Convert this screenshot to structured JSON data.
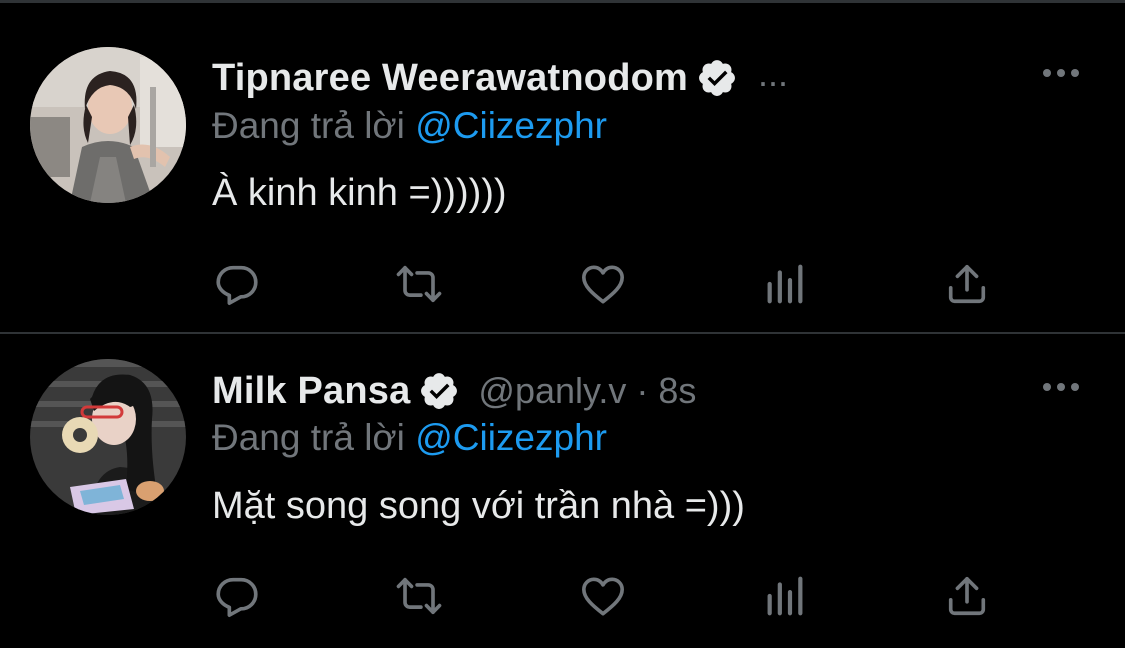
{
  "tweets": [
    {
      "display_name": "Tipnaree Weerawatnodom",
      "verified": true,
      "handle": "",
      "time": "",
      "header_overflow": "...",
      "replying_prefix": "Đang trả lời",
      "replying_to": "@Ciizezphr",
      "text": "À kinh kinh =))))))",
      "icons": {
        "verified": "verified-badge-icon",
        "more": "more-horizontal-icon",
        "reply": "reply-icon",
        "retweet": "retweet-icon",
        "like": "heart-icon",
        "analytics": "analytics-icon",
        "share": "share-icon"
      }
    },
    {
      "display_name": "Milk Pansa",
      "verified": true,
      "handle": "@panly.v · 8s",
      "replying_prefix": "Đang trả lời",
      "replying_to": "@Ciizezphr",
      "text": "Mặt song song với trần nhà =)))",
      "icons": {
        "verified": "verified-badge-icon",
        "more": "more-horizontal-icon",
        "reply": "reply-icon",
        "retweet": "retweet-icon",
        "like": "heart-icon",
        "analytics": "analytics-icon",
        "share": "share-icon"
      }
    }
  ],
  "colors": {
    "background": "#000000",
    "text_primary": "#e7e9ea",
    "text_secondary": "#71767b",
    "link": "#1d9bf0",
    "divider": "#2f3336"
  }
}
